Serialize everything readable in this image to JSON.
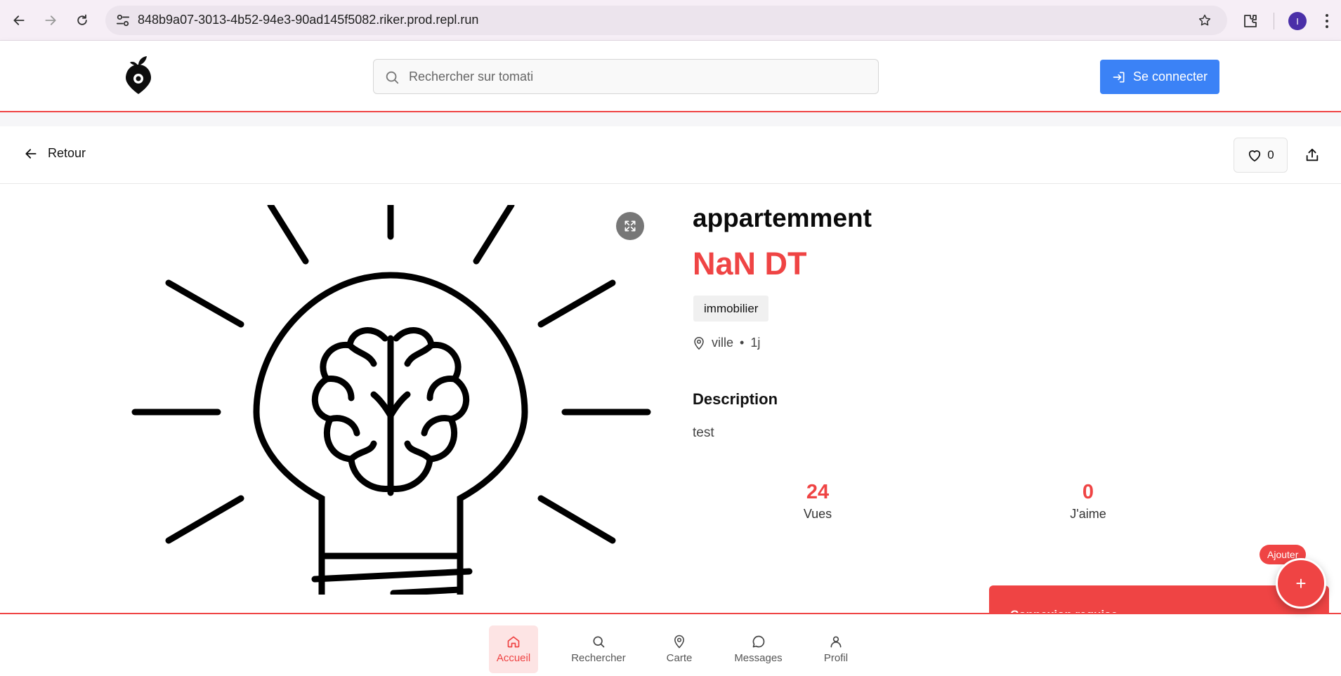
{
  "browser": {
    "url": "848b9a07-3013-4b52-94e3-90ad145f5082.riker.prod.repl.run",
    "avatar_letter": "I"
  },
  "header": {
    "search_placeholder": "Rechercher sur tomati",
    "login_label": "Se connecter",
    "accent_color": "#ef4444",
    "login_color": "#3b82f6"
  },
  "subheader": {
    "back_label": "Retour",
    "like_count": "0"
  },
  "listing": {
    "title": "appartemment",
    "price": "NaN DT",
    "category": "immobilier",
    "location": "ville",
    "separator": "•",
    "age": "1j",
    "description_heading": "Description",
    "description": "test",
    "stats": [
      {
        "value": "24",
        "label": "Vues"
      },
      {
        "value": "0",
        "label": "J'aime"
      }
    ]
  },
  "contact": {
    "label": "Connexion requise"
  },
  "fab": {
    "tooltip": "Ajouter",
    "symbol": "+"
  },
  "bottom_nav": [
    {
      "label": "Accueil",
      "icon": "home-icon",
      "active": true
    },
    {
      "label": "Rechercher",
      "icon": "search-icon",
      "active": false
    },
    {
      "label": "Carte",
      "icon": "map-pin-icon",
      "active": false
    },
    {
      "label": "Messages",
      "icon": "message-icon",
      "active": false
    },
    {
      "label": "Profil",
      "icon": "user-icon",
      "active": false
    }
  ]
}
